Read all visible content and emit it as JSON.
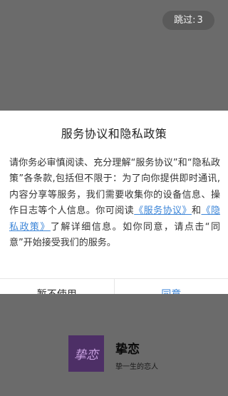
{
  "skip": {
    "label": "跳过:",
    "count": "3"
  },
  "dialog": {
    "title": "服务协议和隐私政策",
    "body_before": "请你务必审慎阅读、充分理解“服务协议”和“隐私政策”各条款,包括但不限于：为了向你提供即时通讯,内容分享等服务，我们需要收集你的设备信息、操作日志等个人信息。你可阅读",
    "link_agreement": "《服务协议》",
    "body_and": "和",
    "link_privacy": "《隐私政策》",
    "body_after": "了解详细信息。如你同意，请点击“同意”开始接受我们的服务。",
    "decline_label": "暂不使用",
    "agree_label": "同意"
  },
  "brand": {
    "logo_text": "挚恋",
    "name": "挚恋",
    "slogan": "挚一生的恋人"
  },
  "colors": {
    "link": "#3d86d8",
    "overlay": "#6b6b6b",
    "logo_bg": "#4d2f66"
  }
}
